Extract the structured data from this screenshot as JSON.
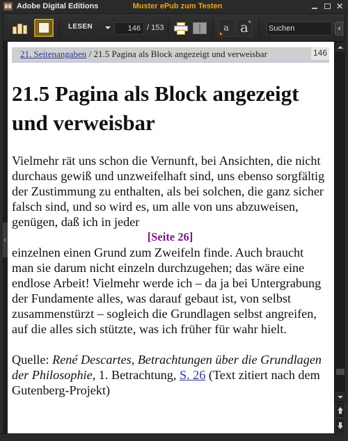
{
  "window": {
    "app_title": "Adobe Digital Editions",
    "document_title": "Muster ePub zum Testen",
    "controls": [
      "minimize",
      "maximize",
      "close"
    ],
    "close_glyph": "✕"
  },
  "toolbar": {
    "library_icon": "bookshelf-icon",
    "reading_icon": "reading-view-icon",
    "view_mode_label": "LESEN",
    "current_page": "146",
    "total_pages": "/ 153",
    "print_icon": "printer-icon",
    "bookmark_icon": "book-icon",
    "font_decrease_label": "a",
    "font_increase_label": "a",
    "search_placeholder": "Suchen"
  },
  "page": {
    "breadcrumb": {
      "parent_link": "21. Seitenangaben",
      "separator": " / ",
      "current": "21.5 Pagina als Block angezeigt und verweisbar"
    },
    "page_number": "146",
    "heading": "21.5 Pagina als Block angezeigt und verweisbar",
    "paragraph_before": "Vielmehr rät uns schon die Vernunft, bei Ansichten, die nicht durchaus gewiß und unzweifelhaft sind, uns ebenso sorgfältig der Zustimmung zu enthalten, als bei solchen, die ganz sicher falsch sind, und so wird es, um alle von uns abzuweisen, genügen, daß ich in jeder",
    "page_marker": "[Seite 26]",
    "paragraph_after": "einzelnen einen Grund zum Zweifeln finde. Auch braucht man sie darum nicht einzeln durchzugehen; das wäre eine endlose Arbeit! Vielmehr werde ich – da ja bei Untergrabung der Fundamente alles, was darauf gebaut ist, von selbst zusammenstürzt – sogleich die Grundlagen selbst angreifen, auf die alles sich stützte, was ich früher für wahr hielt.",
    "source": {
      "label": "Quelle: ",
      "work_italic": "René Descartes, Betrachtungen über die Grundlagen der Philosophie",
      "middle": ", 1. Betrachtung, ",
      "link": "S. 26",
      "suffix": " (Text zitiert nach dem Gutenberg-Projekt)"
    }
  },
  "colors": {
    "accent": "#e8a420",
    "link": "#2a3a9a",
    "page_marker": "#7a1a86",
    "chrome_bg": "#2b2b2b"
  }
}
